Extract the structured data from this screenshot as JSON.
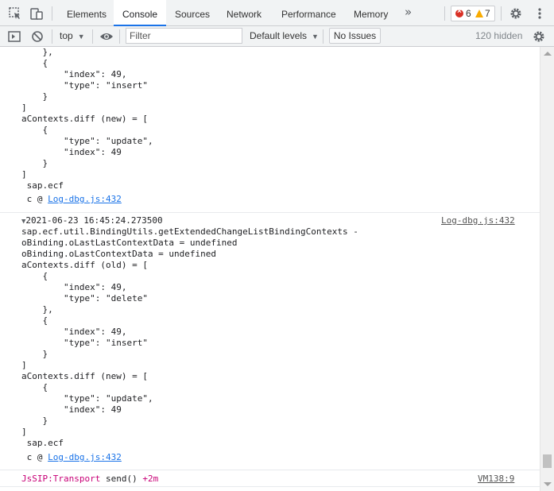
{
  "tabs": [
    "Elements",
    "Console",
    "Sources",
    "Network",
    "Performance",
    "Memory"
  ],
  "more_tabs": "»",
  "issues_badge": {
    "errors": "6",
    "warnings": "7"
  },
  "toolbar": {
    "context": "top",
    "filter_placeholder": "Filter",
    "levels": "Default levels",
    "no_issues": "No Issues",
    "hidden": "120 hidden"
  },
  "icons": {
    "inspect": "inspect-element-icon",
    "device": "device-toolbar-icon",
    "settings": "gear-icon",
    "menu": "kebab-menu-icon",
    "sidebar": "sidebar-toggle-icon",
    "clear": "clear-console-icon",
    "eye": "eye-icon",
    "console_settings": "gear-icon"
  },
  "colors": {
    "accent": "#1a73e8",
    "error": "#d93025",
    "warning": "#f9ab00",
    "jssip": "#c80077"
  },
  "log1": {
    "lines": [
      "    },",
      "    {",
      "        \"index\": 49,",
      "        \"type\": \"insert\"",
      "    }",
      "]",
      "aContexts.diff (new) = [",
      "    {",
      "        \"type\": \"update\",",
      "        \"index\": 49",
      "    }",
      "]",
      " sap.ecf"
    ],
    "caller_prefix": " c @ ",
    "caller_link": "Log-dbg.js:432"
  },
  "log2": {
    "timestamp": "2021-06-23 16:45:24.273500",
    "source": "Log-dbg.js:432",
    "lines": [
      "sap.ecf.util.BindingUtils.getExtendedChangeListBindingContexts -",
      "oBinding.oLastLastContextData = undefined",
      "oBinding.oLastContextData = undefined",
      "aContexts.diff (old) = [",
      "    {",
      "        \"index\": 49,",
      "        \"type\": \"delete\"",
      "    },",
      "    {",
      "        \"index\": 49,",
      "        \"type\": \"insert\"",
      "    }",
      "]",
      "aContexts.diff (new) = [",
      "    {",
      "        \"type\": \"update\",",
      "        \"index\": 49",
      "    }",
      "]",
      " sap.ecf"
    ],
    "caller_prefix": " c @ ",
    "caller_link": "Log-dbg.js:432"
  },
  "log3": {
    "tag": "JsSIP:Transport",
    "text": " send() ",
    "delta": "+2m",
    "source": "VM138:9"
  }
}
